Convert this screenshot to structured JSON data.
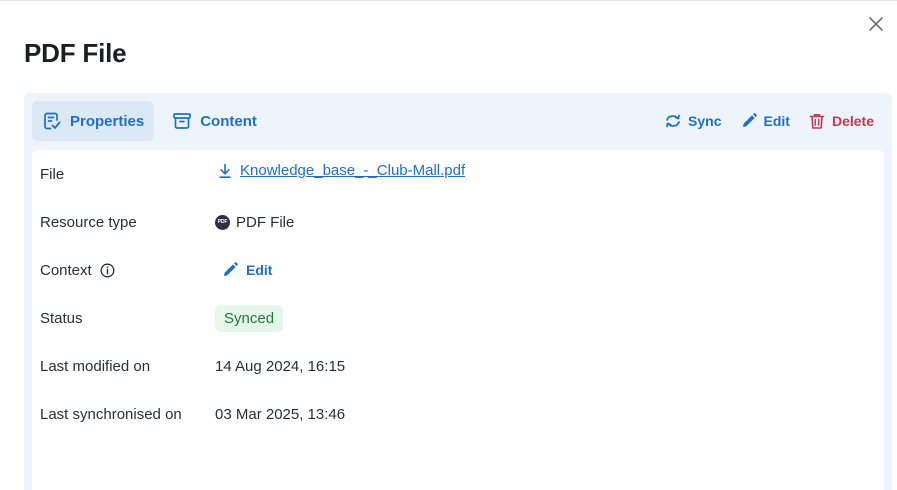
{
  "dialog": {
    "title": "PDF File",
    "close_icon": "close-icon"
  },
  "tabs": [
    {
      "label": "Properties",
      "icon": "properties-icon",
      "active": true
    },
    {
      "label": "Content",
      "icon": "archive-icon",
      "active": false
    }
  ],
  "actions": {
    "sync": "Sync",
    "edit": "Edit",
    "delete": "Delete"
  },
  "properties": {
    "file": {
      "label": "File",
      "value": "Knowledge_base_-_Club-Mall.pdf"
    },
    "resource_type": {
      "label": "Resource type",
      "value": "PDF File",
      "badge": "PDF"
    },
    "context": {
      "label": "Context",
      "edit_label": "Edit"
    },
    "status": {
      "label": "Status",
      "value": "Synced"
    },
    "last_modified": {
      "label": "Last modified on",
      "value": "14 Aug 2024, 16:15"
    },
    "last_synchronised": {
      "label": "Last synchronised on",
      "value": "03 Mar 2025, 13:46"
    }
  },
  "colors": {
    "accent": "#1f6fc8",
    "danger": "#c8374d",
    "panel_bg": "#eef4fb",
    "status_bg": "#e7f6ea",
    "status_text": "#217a3a"
  }
}
